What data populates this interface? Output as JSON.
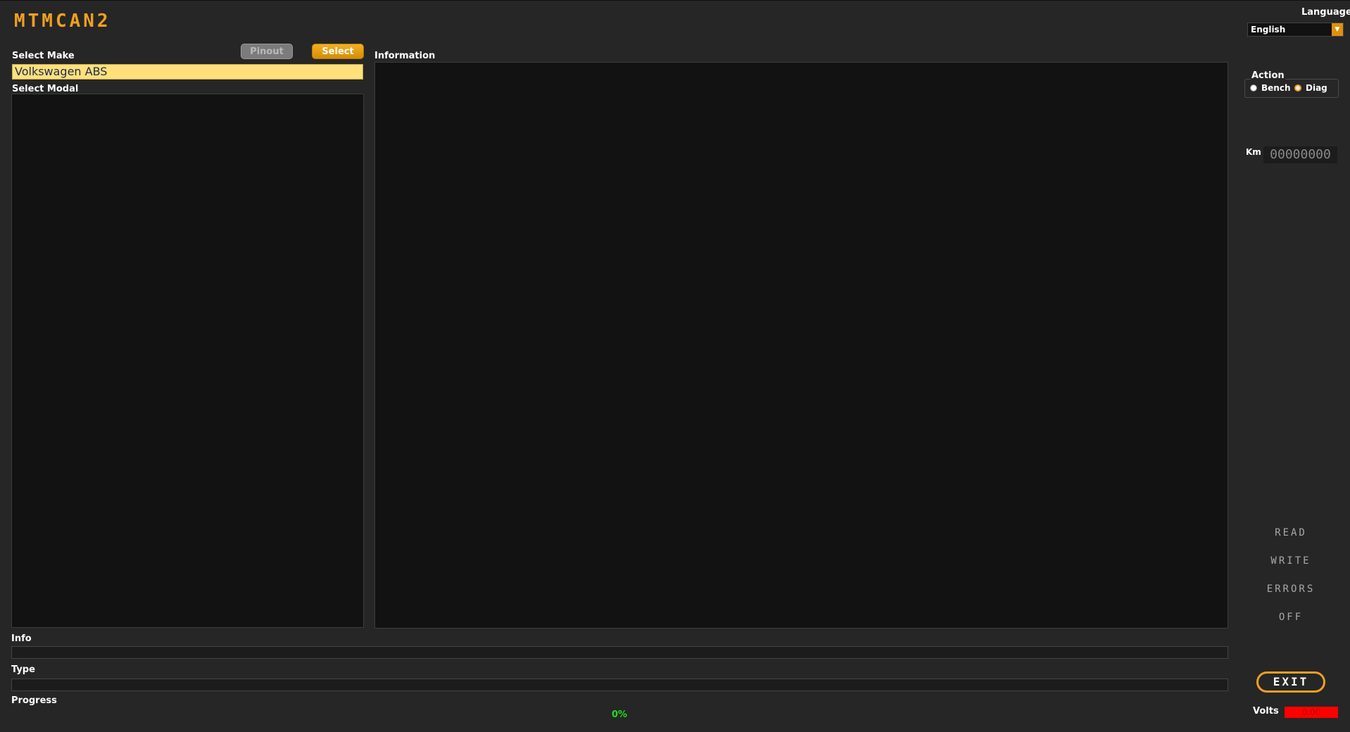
{
  "app": {
    "logo": "MTMCAN2"
  },
  "make": {
    "label": "Select Make",
    "value": "Volkswagen ABS",
    "pinout_label": "Pinout",
    "select_label": "Select"
  },
  "modal": {
    "label": "Select Modal",
    "items": []
  },
  "information": {
    "label": "Information"
  },
  "status": {
    "info_label": "Info",
    "type_label": "Type",
    "progress_label": "Progress",
    "progress_value": "0%"
  },
  "language": {
    "label": "Language",
    "selected": "English"
  },
  "action": {
    "label": "Action",
    "options": [
      "Bench",
      "Diag"
    ],
    "selected": "Diag"
  },
  "km": {
    "label": "Km",
    "value": "00000000"
  },
  "buttons": {
    "read": "READ",
    "write": "WRITE",
    "errors": "ERRORS",
    "off": "OFF",
    "exit": "EXIT"
  },
  "volts": {
    "label": "Volts",
    "value": "0.00"
  },
  "colors": {
    "accent": "#f0a020",
    "background": "#262626",
    "panel": "#121212",
    "make_field": "#ffe07a",
    "progress_text": "#22dd22",
    "volts_bg": "#ff0000"
  }
}
